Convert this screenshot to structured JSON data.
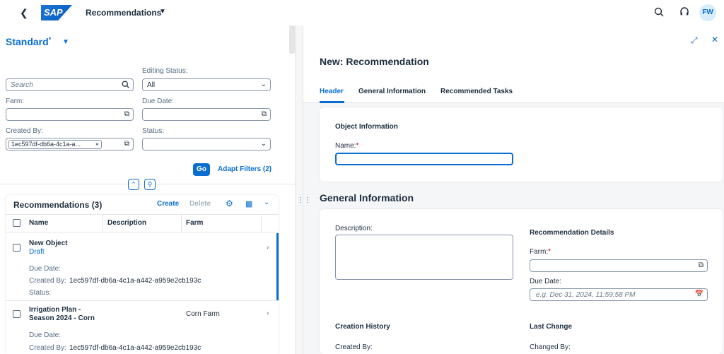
{
  "shell": {
    "app_title": "Recommendations",
    "avatar_initials": "FW",
    "logo_text": "SAP"
  },
  "filter_bar": {
    "variant": "Standard",
    "variant_modified": "*",
    "search_placeholder": "Search",
    "editing_status_label": "Editing Status:",
    "editing_status_value": "All",
    "farm_label": "Farm:",
    "due_date_label": "Due Date:",
    "created_by_label": "Created By:",
    "created_by_token": "1ec597df-db6a-4c1a-a...",
    "status_label": "Status:",
    "go_label": "Go",
    "adapt_filters_label": "Adapt Filters (2)"
  },
  "table": {
    "title": "Recommendations (3)",
    "create_label": "Create",
    "delete_label": "Delete",
    "columns": [
      "Name",
      "Description",
      "Farm"
    ],
    "rows": [
      {
        "name": "New Object",
        "status": "Draft",
        "farm": "",
        "due_date_label": "Due Date:",
        "created_by_label": "Created By:",
        "created_by": "1ec597df-db6a-4c1a-a442-a959e2cb193c",
        "status_label": "Status:"
      },
      {
        "name_line1": "Irrigation Plan -",
        "name_line2": "Season 2024 - Corn",
        "farm": "Corn Farm",
        "due_date_label": "Due Date:",
        "created_by_label": "Created By:",
        "created_by": "1ec597df-db6a-4c1a-a442-a959e2cb193c"
      }
    ]
  },
  "object_page": {
    "title": "New: Recommendation",
    "tabs": [
      "Header",
      "General Information",
      "Recommended Tasks"
    ],
    "object_info_header": "Object Information",
    "name_label": "Name:",
    "general_info_header": "General Information",
    "description_label": "Description:",
    "recommendation_details_header": "Recommendation Details",
    "farm_label": "Farm:",
    "due_date_label": "Due Date:",
    "due_date_placeholder": "e.g. Dec 31, 2024, 11:59:58 PM",
    "creation_history_header": "Creation History",
    "created_by_label": "Created By:",
    "last_change_header": "Last Change",
    "changed_by_label": "Changed By:",
    "required_marker": "*"
  },
  "colors": {
    "accent": "#0a6ed1",
    "text": "#1d2d3e",
    "required": "#bb0000"
  },
  "icons": [
    "back-icon",
    "search-icon",
    "help-headset-icon",
    "value-help-icon",
    "chevron-down-icon",
    "gear-icon",
    "export-icon",
    "fullscreen-icon",
    "close-icon",
    "calendar-icon",
    "pin-icon",
    "collapse-icon"
  ]
}
